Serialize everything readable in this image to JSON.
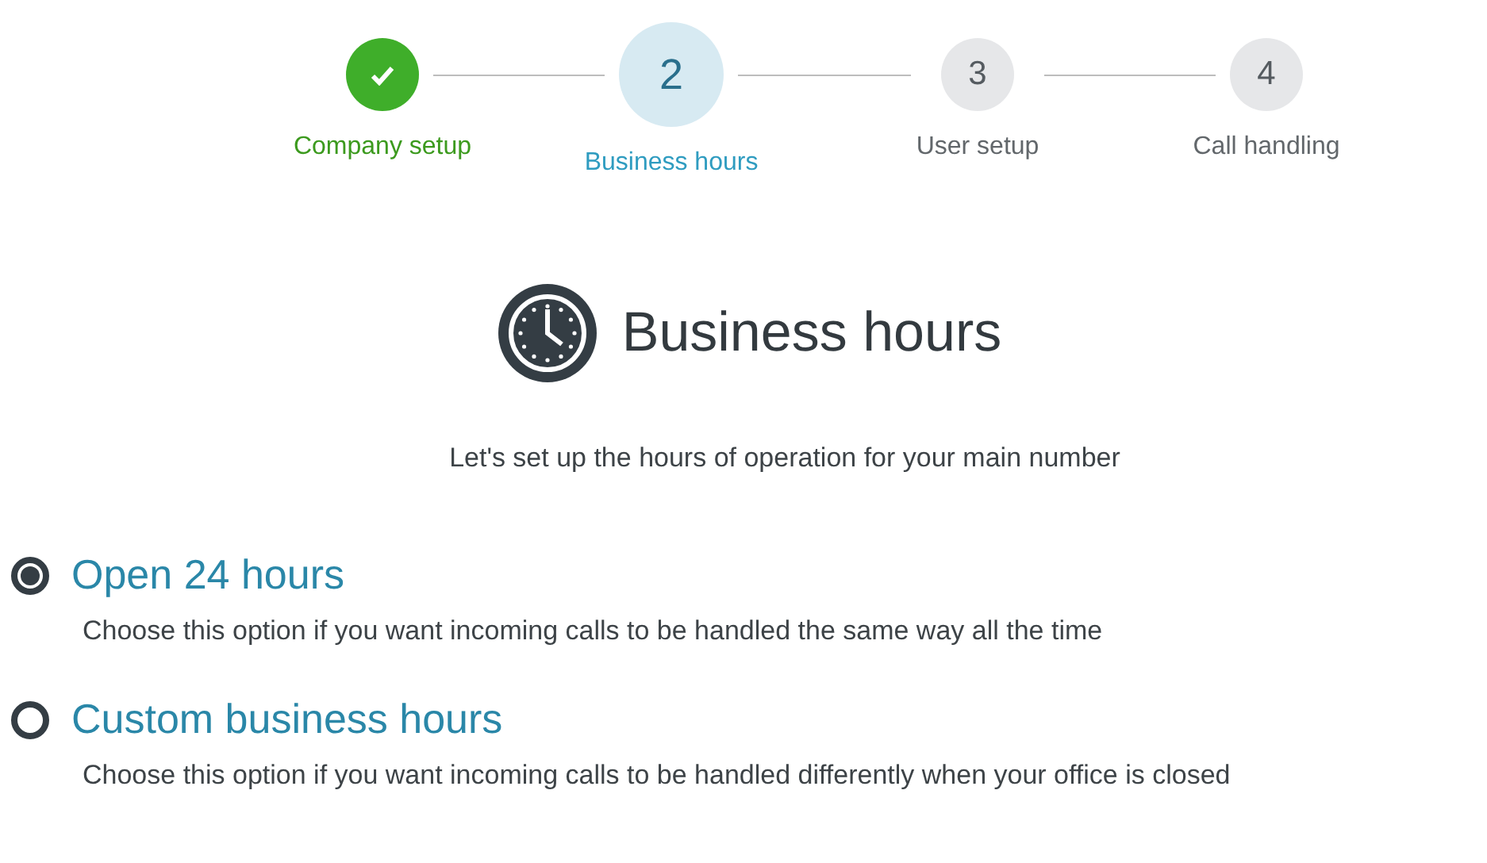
{
  "steps": [
    {
      "label": "Company setup",
      "completed": true,
      "selected": false
    },
    {
      "number": "2",
      "label": "Business hours",
      "completed": false,
      "selected": true
    },
    {
      "number": "3",
      "label": "User setup",
      "completed": false,
      "selected": false
    },
    {
      "number": "4",
      "label": "Call handling",
      "completed": false,
      "selected": false
    }
  ],
  "heading": {
    "title": "Business hours",
    "subtitle": "Let's set up the hours of operation for your main number"
  },
  "options": [
    {
      "title": "Open 24 hours",
      "description": "Choose this option if you want incoming calls to be handled the same way all the time",
      "selected": true
    },
    {
      "title": "Custom business hours",
      "description": "Choose this option if you want incoming calls to be handled differently when your office is closed",
      "selected": false
    }
  ]
}
